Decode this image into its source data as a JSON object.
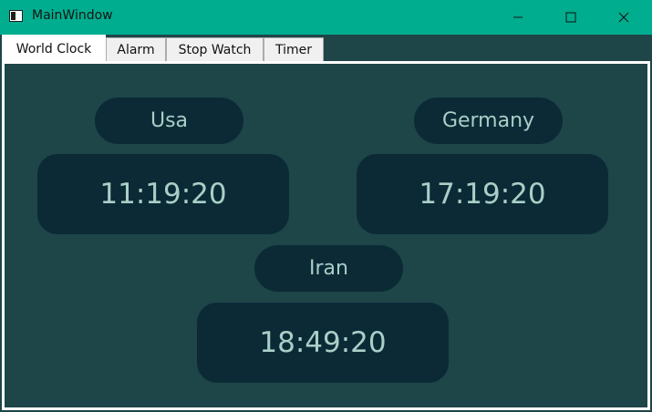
{
  "window": {
    "title": "MainWindow",
    "icon": "app-window-icon",
    "controls": [
      "minimize-icon",
      "maximize-icon",
      "close-icon"
    ]
  },
  "tabs": [
    {
      "label": "World Clock",
      "active": true
    },
    {
      "label": "Alarm",
      "active": false
    },
    {
      "label": "Stop Watch",
      "active": false
    },
    {
      "label": "Timer",
      "active": false
    }
  ],
  "clocks": {
    "usa": {
      "name": "Usa",
      "time": "11:19:20"
    },
    "germany": {
      "name": "Germany",
      "time": "17:19:20"
    },
    "iran": {
      "name": "Iran",
      "time": "18:49:20"
    }
  },
  "colors": {
    "titlebar": "#00ad8e",
    "background": "#1e4548",
    "pill": "#0b2a36",
    "pill_text": "#a9cfc7"
  }
}
